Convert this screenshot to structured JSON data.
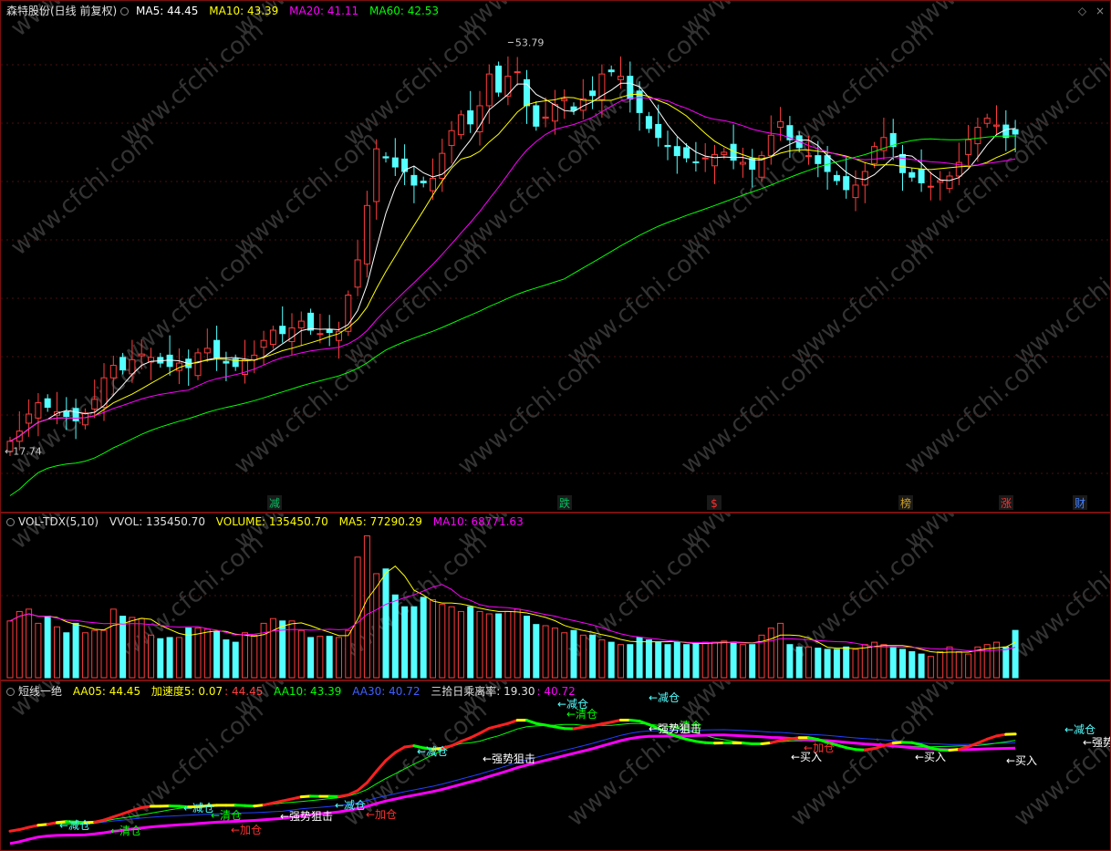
{
  "main": {
    "title": "森特股份(日线 前复权)",
    "ma5_label": "MA5: 44.45",
    "ma10_label": "MA10: 43.39",
    "ma20_label": "MA20: 41.11",
    "ma60_label": "MA60: 42.53",
    "high_label": "53.79",
    "low_label": "←17.74",
    "events": [
      "减",
      "跌",
      "$",
      "榜",
      "涨",
      "财"
    ]
  },
  "volume": {
    "title": "VOL-TDX(5,10)",
    "vvol_label": "VVOL: 135450.70",
    "volume_label": "VOLUME: 135450.70",
    "ma5_label": "MA5: 77290.29",
    "ma10_label": "MA10: 68771.63"
  },
  "indicator": {
    "title": "短线一绝",
    "aa05_label": "AA05: 44.45",
    "accel_label": "加速度5: 0.07",
    "accel_value": ": 44.45",
    "aa10_label": "AA10: 43.39",
    "aa30_label": "AA30: 40.72",
    "ratio_label": "三拾日乘离率: 19.30",
    "ratio_value": ": 40.72",
    "signals": [
      "←减仓",
      "←清仓",
      "←减仓",
      "←清仓",
      "←强势狙击",
      "←减仓",
      "←强势狙击",
      "←买入",
      "←买入",
      "←买入",
      "←减仓",
      "←强势",
      "←减仓",
      "←清仓",
      "←加仓",
      "←减仓",
      "←强势狙击",
      "←加仓",
      "←减仓",
      "←清仓",
      "←加仓"
    ]
  },
  "watermark": "www.cfchi.com",
  "colors": {
    "up": "#ff3c3c",
    "down": "#54ffff",
    "ma5": "#ffffff",
    "ma10": "#ffff00",
    "ma20": "#ff00ff",
    "ma60": "#00ff00",
    "border": "#7a1010",
    "aa30": "#2040ff"
  },
  "chart_data": {
    "type": "candlestick",
    "closes": [
      18.6,
      19.5,
      21.0,
      22.0,
      21.6,
      21.2,
      20.8,
      20.4,
      21.1,
      22.3,
      24.2,
      25.3,
      24.9,
      25.8,
      26.3,
      26.0,
      25.5,
      25.2,
      25.5,
      25.1,
      26.4,
      26.8,
      26.0,
      25.5,
      25.2,
      25.8,
      26.2,
      27.5,
      28.4,
      28.1,
      28.6,
      29.2,
      28.4,
      28.1,
      28.2,
      28.3,
      31.5,
      34.6,
      39.4,
      44.4,
      43.6,
      42.8,
      42.4,
      41.2,
      41.4,
      41.8,
      44.0,
      46.0,
      47.4,
      46.6,
      48.2,
      51.0,
      49.4,
      50.8,
      51.2,
      48.2,
      46.4,
      47.2,
      48.3,
      48.8,
      47.8,
      48.8,
      49.1,
      51.0,
      51.2,
      50.8,
      48.8,
      47.6,
      46.2,
      45.4,
      44.6,
      43.8,
      43.6,
      43.2,
      43.6,
      43.9,
      44.1,
      43.4,
      43.2,
      42.6,
      43.8,
      45.6,
      46.8,
      45.2,
      44.5,
      43.8,
      43.1,
      42.4,
      41.6,
      40.8,
      41.2,
      42.4,
      44.6,
      45.4,
      44.6,
      42.3,
      41.9,
      41.4,
      41.1,
      41.6,
      42.0,
      43.2,
      45.2,
      46.3,
      47.1,
      46.5,
      45.4,
      45.7
    ],
    "volumes": [
      48000,
      56000,
      58000,
      46000,
      52000,
      43000,
      38000,
      46000,
      38000,
      40000,
      40000,
      58000,
      52000,
      51000,
      50000,
      36000,
      33000,
      34000,
      34000,
      42000,
      42000,
      41000,
      39000,
      32000,
      30000,
      38000,
      36000,
      46000,
      50000,
      48000,
      48000,
      40000,
      34000,
      35000,
      35000,
      34000,
      40000,
      102000,
      120000,
      88000,
      92000,
      70000,
      60000,
      60000,
      68000,
      66000,
      62000,
      60000,
      56000,
      60000,
      56000,
      54000,
      54000,
      56000,
      58000,
      52000,
      45000,
      44000,
      42000,
      38000,
      40000,
      36000,
      36000,
      32000,
      30000,
      28000,
      28000,
      34000,
      32000,
      30000,
      28000,
      30000,
      28000,
      29000,
      30000,
      30000,
      31000,
      30000,
      28000,
      28000,
      36000,
      42000,
      46000,
      28000,
      26000,
      26000,
      25000,
      24000,
      24000,
      26000,
      24000,
      28000,
      30000,
      28000,
      26000,
      24000,
      22000,
      20000,
      18000,
      22000,
      26000,
      22000,
      20000,
      26000,
      28000,
      30000,
      26000,
      40000
    ],
    "ma5": 44.45,
    "ma10": 43.39,
    "ma20": 41.11,
    "ma60": 42.53,
    "high": 53.79,
    "low": 17.74
  }
}
